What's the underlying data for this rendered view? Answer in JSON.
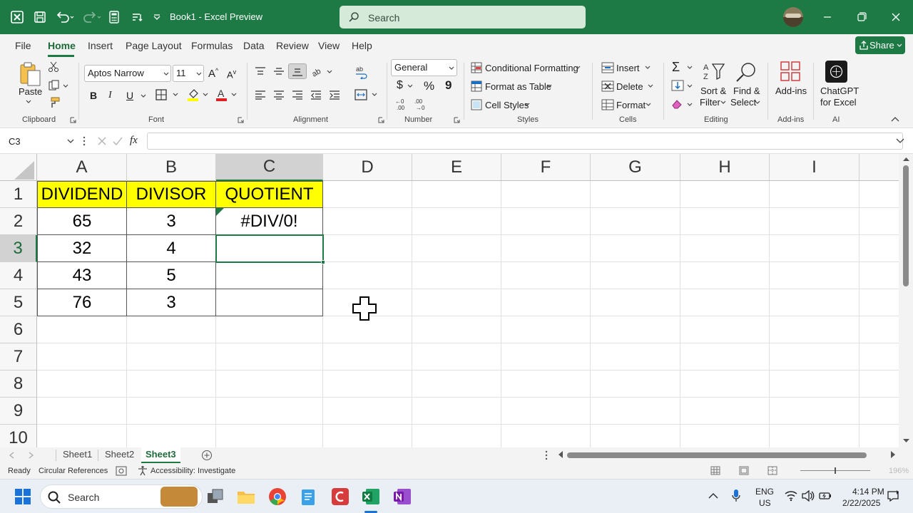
{
  "titlebar": {
    "doc_title": "Book1  -  Excel Preview",
    "search_placeholder": "Search"
  },
  "tabs": [
    "File",
    "Home",
    "Insert",
    "Page Layout",
    "Formulas",
    "Data",
    "Review",
    "View",
    "Help"
  ],
  "share_label": "Share",
  "ribbon": {
    "clipboard": {
      "paste": "Paste",
      "label": "Clipboard"
    },
    "font": {
      "name": "Aptos Narrow",
      "size": "11",
      "label": "Font",
      "bold": "B",
      "italic": "I",
      "underline": "U"
    },
    "alignment": {
      "label": "Alignment"
    },
    "number": {
      "format": "General",
      "label": "Number",
      "currency": "$",
      "percent": "%",
      "comma": "9"
    },
    "styles": {
      "conditional": "Conditional Formatting",
      "format_table": "Format as Table",
      "cell_styles": "Cell Styles",
      "label": "Styles"
    },
    "cells": {
      "insert": "Insert",
      "delete": "Delete",
      "format": "Format",
      "label": "Cells"
    },
    "editing": {
      "sort_filter_1": "Sort &",
      "sort_filter_2": "Filter",
      "find_select_1": "Find &",
      "find_select_2": "Select",
      "label": "Editing"
    },
    "addins": {
      "addins_label": "Add-ins",
      "label": "Add-ins"
    },
    "ai": {
      "chatgpt_1": "ChatGPT",
      "chatgpt_2": "for Excel",
      "label": "AI"
    }
  },
  "formula_bar": {
    "name_box": "C3",
    "fx": "fx",
    "formula": ""
  },
  "grid": {
    "columns": [
      "A",
      "B",
      "C",
      "D",
      "E",
      "F",
      "G",
      "H",
      "I"
    ],
    "rows": [
      "1",
      "2",
      "3",
      "4",
      "5",
      "6",
      "7",
      "8",
      "9",
      "10"
    ],
    "selected_col": "C",
    "selected_row": "3",
    "table": {
      "headers": [
        "DIVIDEND",
        "DIVISOR",
        "QUOTIENT"
      ],
      "rows": [
        [
          "65",
          "3",
          "#DIV/0!"
        ],
        [
          "32",
          "4",
          ""
        ],
        [
          "43",
          "5",
          ""
        ],
        [
          "76",
          "3",
          ""
        ]
      ]
    }
  },
  "sheets": [
    "Sheet1",
    "Sheet2",
    "Sheet3"
  ],
  "active_sheet": "Sheet3",
  "status": {
    "ready": "Ready",
    "circular": "Circular References",
    "accessibility": "Accessibility: Investigate",
    "zoom": "196%"
  },
  "taskbar": {
    "search": "Search",
    "lang_1": "ENG",
    "lang_2": "US",
    "time": "4:14 PM",
    "date": "2/22/2025"
  },
  "colors": {
    "excel_green": "#1e7a45",
    "header_yellow": "#ffff00"
  }
}
